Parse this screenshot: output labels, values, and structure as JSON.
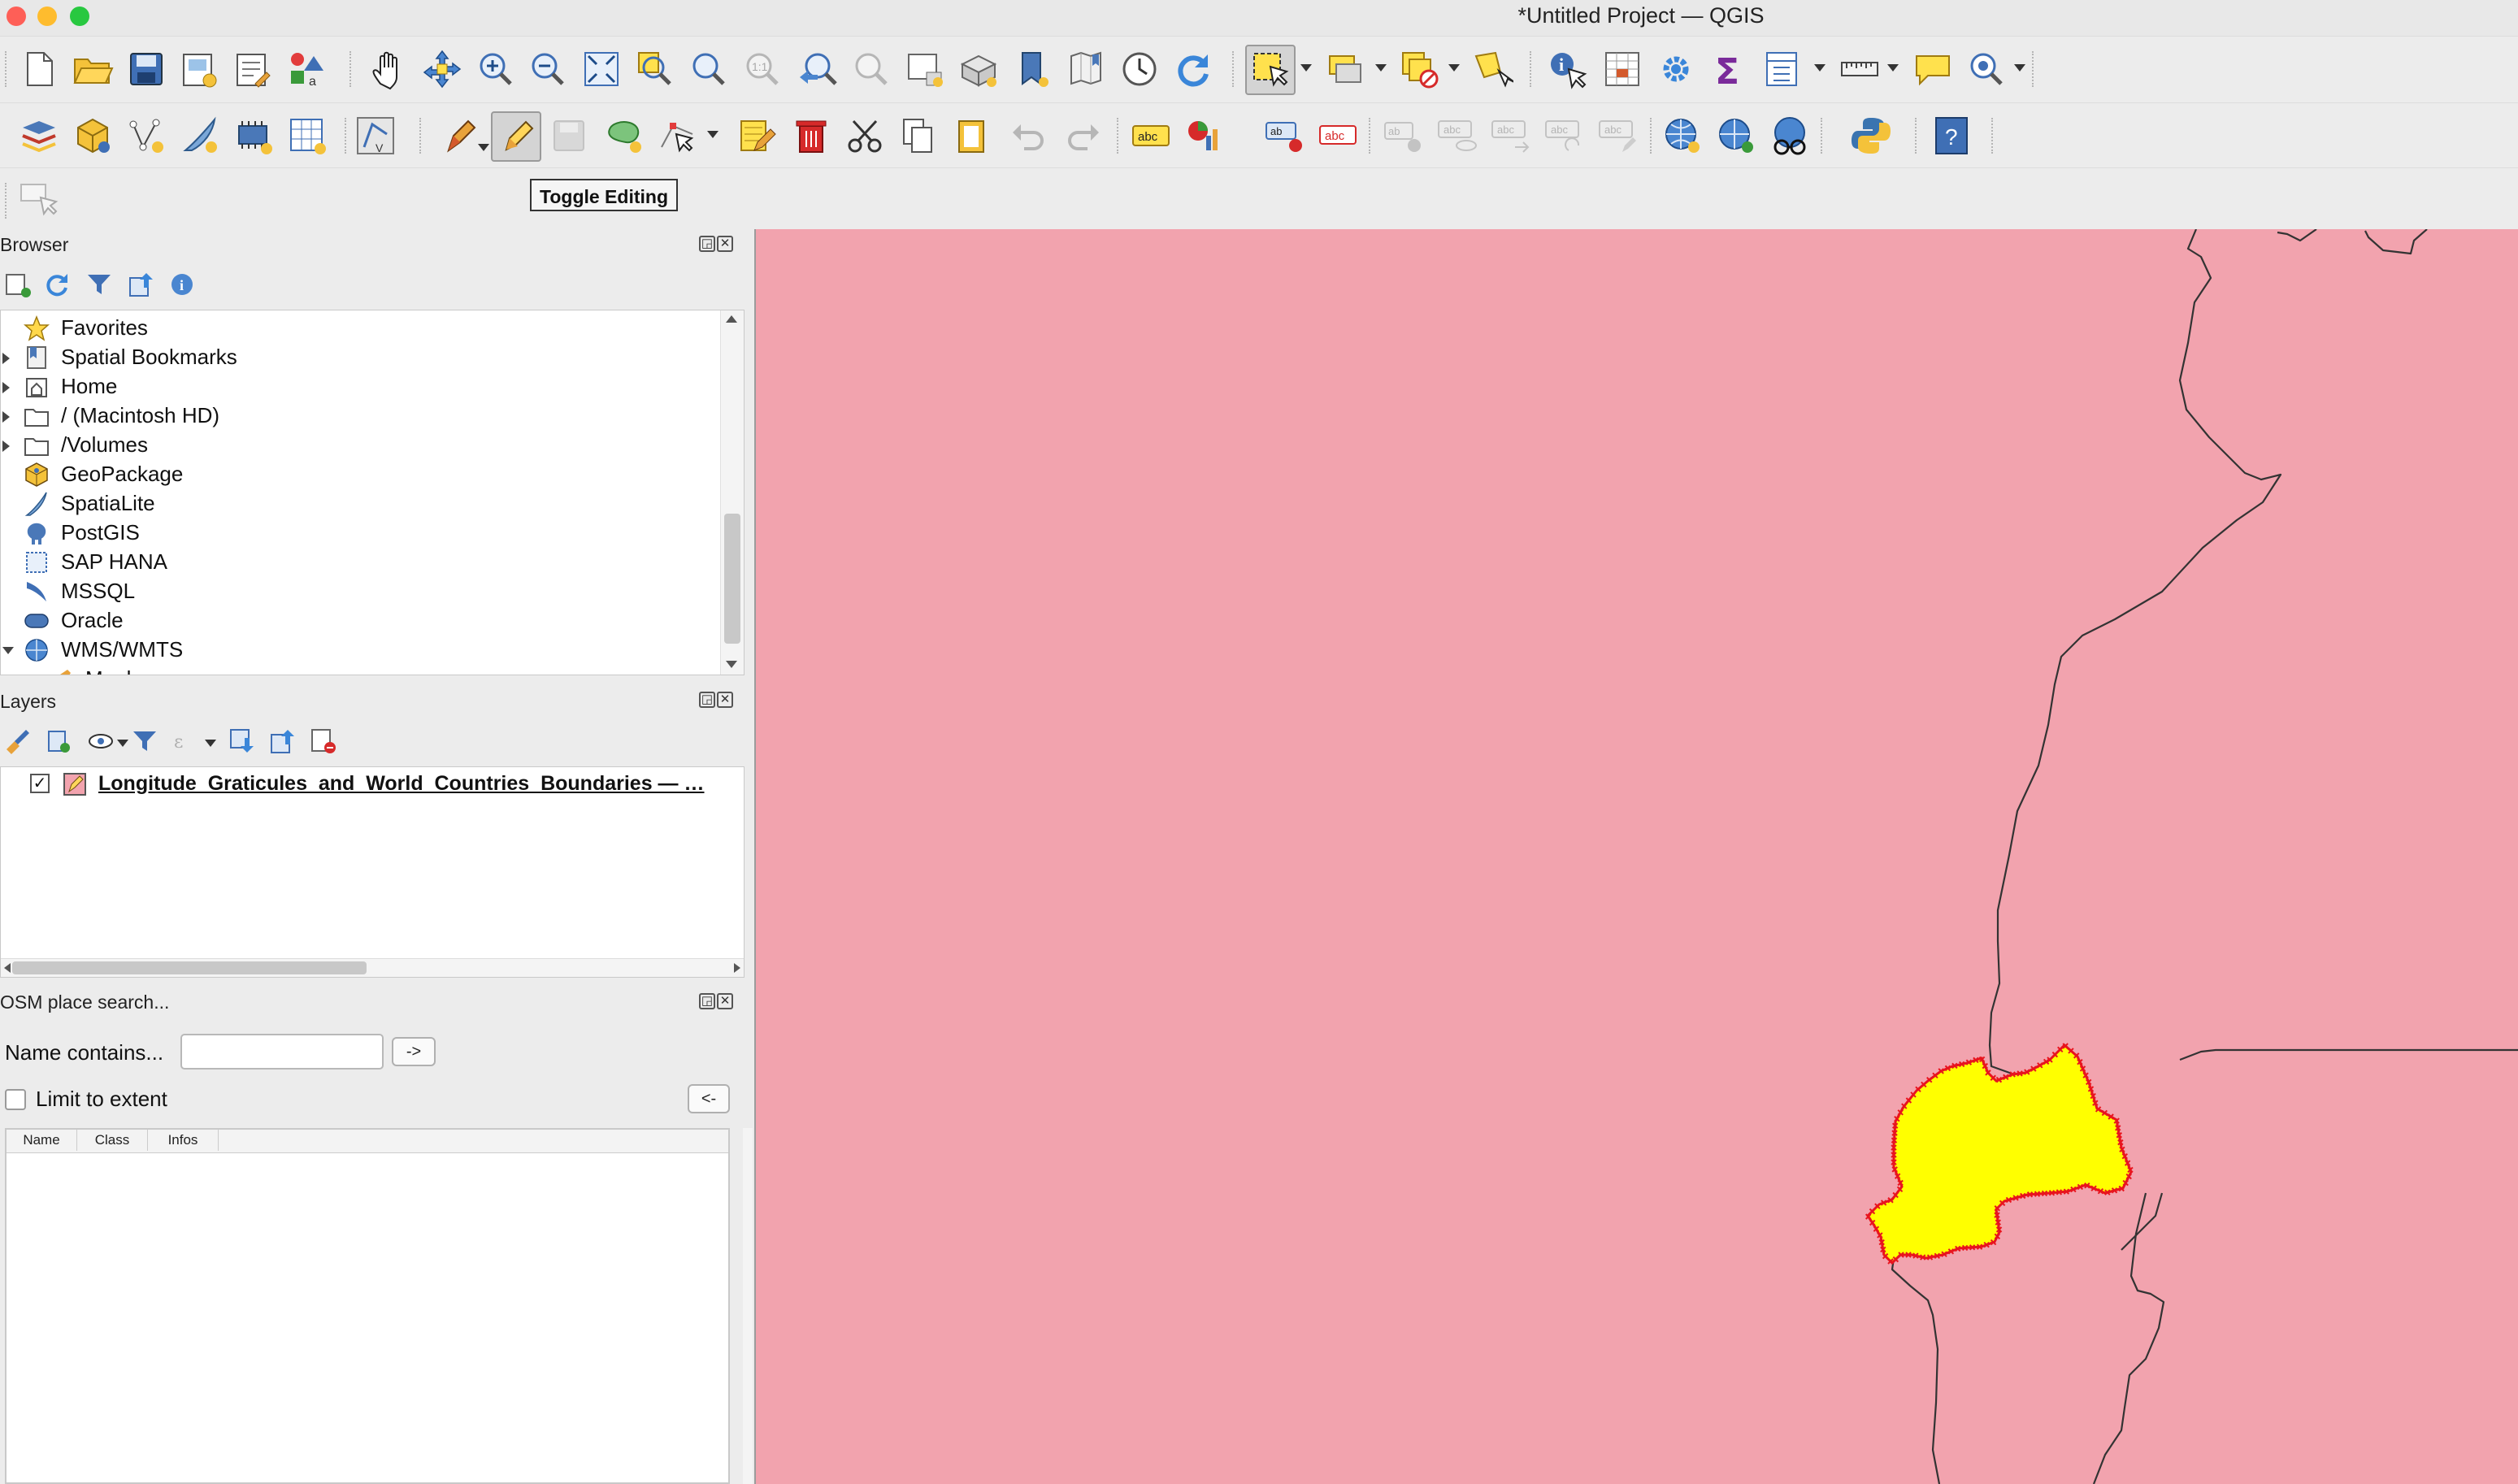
{
  "window": {
    "title": "*Untitled Project — QGIS"
  },
  "tooltip": {
    "text": "Toggle Editing"
  },
  "browser_panel": {
    "title": "Browser",
    "items": [
      {
        "label": "Favorites",
        "icon": "star-icon",
        "expandable": false
      },
      {
        "label": "Spatial Bookmarks",
        "icon": "bookmark-icon",
        "expandable": true
      },
      {
        "label": "Home",
        "icon": "home-icon",
        "expandable": true
      },
      {
        "label": "/ (Macintosh HD)",
        "icon": "folder-icon",
        "expandable": true
      },
      {
        "label": "/Volumes",
        "icon": "folder-icon",
        "expandable": true
      },
      {
        "label": "GeoPackage",
        "icon": "geopackage-icon",
        "expandable": false
      },
      {
        "label": "SpatiaLite",
        "icon": "spatialite-icon",
        "expandable": false
      },
      {
        "label": "PostGIS",
        "icon": "postgis-elephant-icon",
        "expandable": false
      },
      {
        "label": "SAP HANA",
        "icon": "sap-hana-icon",
        "expandable": false
      },
      {
        "label": "MSSQL",
        "icon": "mssql-icon",
        "expandable": false
      },
      {
        "label": "Oracle",
        "icon": "oracle-icon",
        "expandable": false
      },
      {
        "label": "WMS/WMTS",
        "icon": "globe-icon",
        "expandable": true,
        "expanded": true
      },
      {
        "label": "Mapbox",
        "icon": "mapbox-icon",
        "expandable": false
      }
    ]
  },
  "layers_panel": {
    "title": "Layers",
    "layers": [
      {
        "name": "Longitude_Graticules_and_World_Countries_Boundaries — …",
        "checked": true,
        "icon": "polygon-layer-editing-icon"
      }
    ]
  },
  "osm_panel": {
    "title": "OSM place search...",
    "name_label": "Name contains...",
    "name_value": "",
    "go_button": "->",
    "limit_label": "Limit to extent",
    "limit_checked": false,
    "back_button": "<-",
    "columns": [
      "Name",
      "Class",
      "Infos"
    ]
  },
  "colors": {
    "map_background": "#f2a3ae",
    "selected_feature": "#ffff00",
    "vertex_markers": "#e8141e",
    "boundary_lines": "#333333"
  }
}
